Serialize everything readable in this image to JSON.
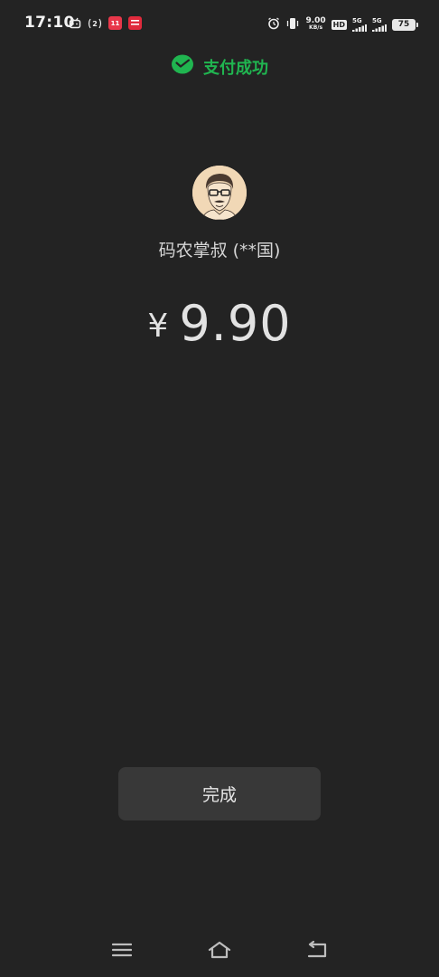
{
  "status_bar": {
    "time": "17:10",
    "net_speed_value": "9.00",
    "net_speed_unit": "KB/s",
    "hd_label": "HD",
    "sim1_label": "5G",
    "sim2_label": "5G",
    "battery_level": "75",
    "app_badge_1": "双11",
    "app_badge_2": "天猫"
  },
  "header": {
    "title": "支付成功",
    "icon": "wechat-pay-icon",
    "accent_color": "#20b550"
  },
  "payee": {
    "name": "码农掌叔 (**国)"
  },
  "payment": {
    "currency_symbol": "¥",
    "amount": "9.90"
  },
  "actions": {
    "done_label": "完成"
  },
  "navigation": {
    "menu_icon": "menu-icon",
    "home_icon": "home-icon",
    "back_icon": "back-icon"
  }
}
